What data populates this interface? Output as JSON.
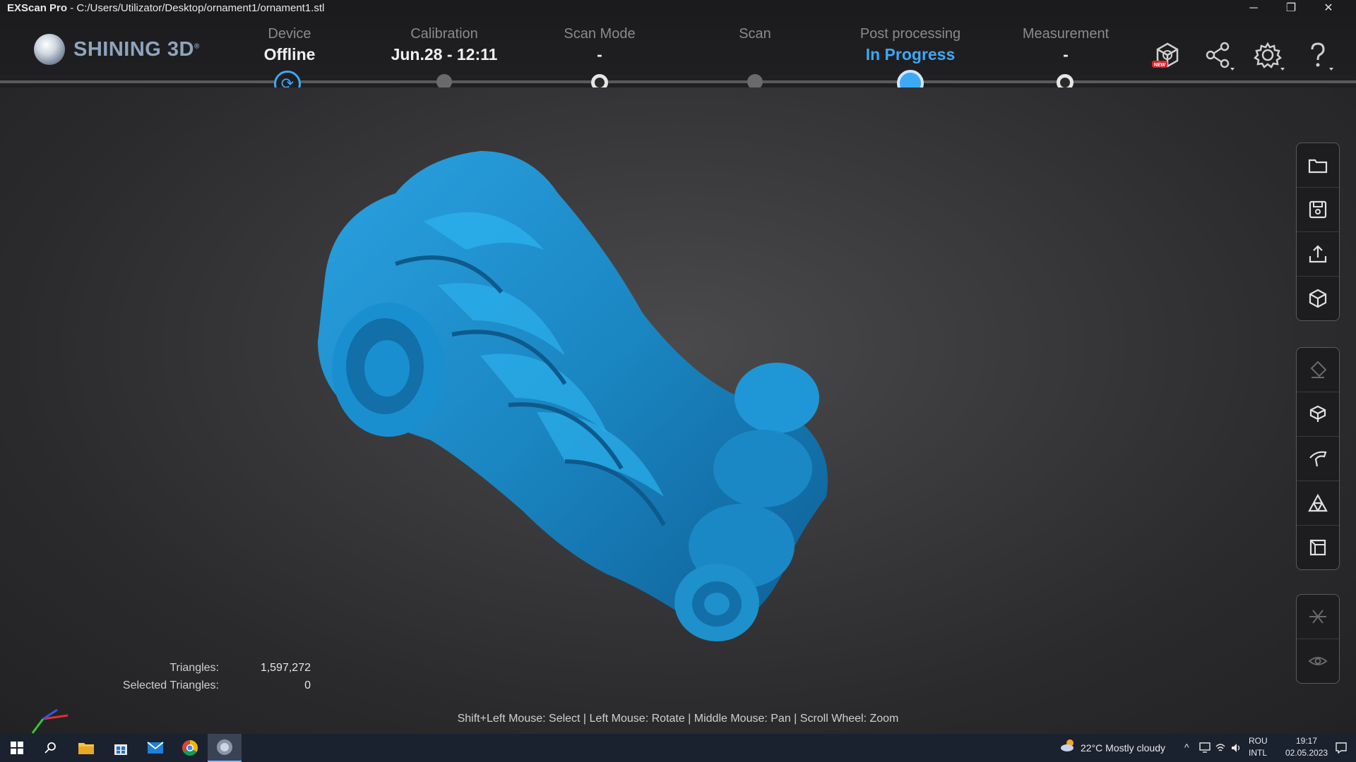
{
  "window": {
    "app_name": "EXScan Pro",
    "separator": "-",
    "file_path": "C:/Users/Utilizator/Desktop/ornament1/ornament1.stl",
    "minimize": "─",
    "restore": "❐",
    "close": "✕"
  },
  "logo": {
    "text": "SHINING 3D",
    "reg": "®"
  },
  "steps": [
    {
      "label": "Device",
      "value": "Offline",
      "state": "sync"
    },
    {
      "label": "Calibration",
      "value": "Jun.28 - 12:11",
      "state": "dot"
    },
    {
      "label": "Scan Mode",
      "value": "-",
      "state": "ring"
    },
    {
      "label": "Scan",
      "value": "",
      "state": "dot"
    },
    {
      "label": "Post processing",
      "value": "In Progress",
      "state": "active"
    },
    {
      "label": "Measurement",
      "value": "-",
      "state": "ring"
    }
  ],
  "header_icons": [
    "new-feature-icon",
    "share-icon",
    "settings-icon",
    "help-icon"
  ],
  "header_badge": "NEW",
  "stats": {
    "triangles_label": "Triangles:",
    "triangles_value": "1,597,272",
    "selected_label": "Selected Triangles:",
    "selected_value": "0"
  },
  "hint": "Shift+Left Mouse: Select | Left Mouse: Rotate | Middle Mouse: Pan | Scroll Wheel: Zoom",
  "toolbar_groups": [
    [
      "open-folder-icon",
      "save-icon",
      "export-icon",
      "cube-icon"
    ],
    [
      "eraser-icon",
      "box-cut-icon",
      "curve-icon",
      "triangle-mesh-icon",
      "frame-box-icon"
    ],
    [
      "mirror-icon",
      "eye-icon"
    ]
  ],
  "colors": {
    "accent": "#3ea8f5",
    "model": "#1e86c4",
    "taskbar": "#1a2230"
  },
  "taskbar": {
    "weather": "22°C  Mostly cloudy",
    "lang1": "ROU",
    "lang2": "INTL",
    "time": "19:17",
    "date": "02.05.2023"
  }
}
